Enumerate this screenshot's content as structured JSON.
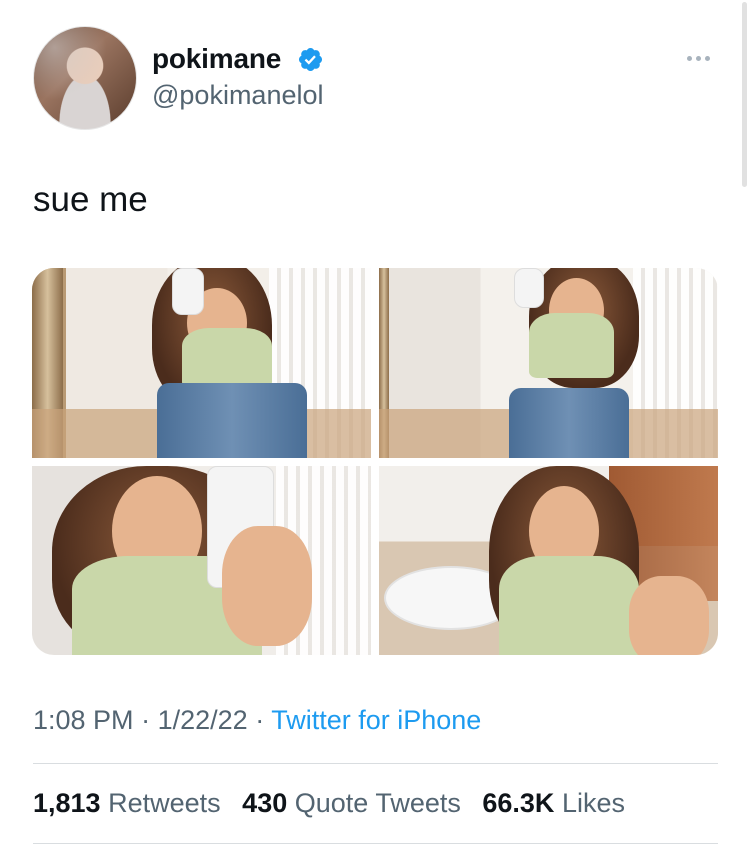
{
  "user": {
    "display_name": "pokimane",
    "handle": "@pokimanelol",
    "verified": true
  },
  "tweet": {
    "text": "sue me",
    "time": "1:08 PM",
    "date": "1/22/22",
    "source": "Twitter for iPhone",
    "separator": "·"
  },
  "stats": {
    "retweets_count": "1,813",
    "retweets_label": "Retweets",
    "quotes_count": "430",
    "quotes_label": "Quote Tweets",
    "likes_count": "66.3K",
    "likes_label": "Likes"
  },
  "icons": {
    "verified": "verified-badge-icon",
    "more": "more-options-icon"
  },
  "colors": {
    "accent": "#1d9bf0",
    "text": "#0f1419",
    "secondary": "#536471"
  }
}
